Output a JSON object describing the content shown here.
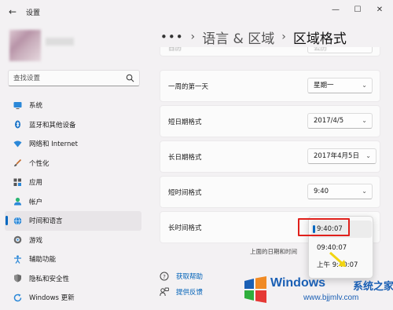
{
  "window": {
    "title": "设置",
    "back_icon": "←",
    "minimize_icon": "—",
    "maximize_icon": "☐",
    "close_icon": "✕"
  },
  "search": {
    "placeholder": "查找设置"
  },
  "sidebar": {
    "items": [
      {
        "label": "系统",
        "icon": "system-icon",
        "active": false
      },
      {
        "label": "蓝牙和其他设备",
        "icon": "bluetooth-icon",
        "active": false
      },
      {
        "label": "网络和 Internet",
        "icon": "network-icon",
        "active": false
      },
      {
        "label": "个性化",
        "icon": "brush-icon",
        "active": false
      },
      {
        "label": "应用",
        "icon": "apps-icon",
        "active": false
      },
      {
        "label": "帐户",
        "icon": "account-icon",
        "active": false
      },
      {
        "label": "时间和语言",
        "icon": "globe-icon",
        "active": true
      },
      {
        "label": "游戏",
        "icon": "game-icon",
        "active": false
      },
      {
        "label": "辅助功能",
        "icon": "accessibility-icon",
        "active": false
      },
      {
        "label": "隐私和安全性",
        "icon": "shield-icon",
        "active": false
      },
      {
        "label": "Windows 更新",
        "icon": "update-icon",
        "active": false
      }
    ]
  },
  "breadcrumb": {
    "more": "•••",
    "sep1": "›",
    "item1": "语言 & 区域",
    "sep2": "›",
    "current": "区域格式"
  },
  "settings": {
    "partial_row": {
      "label": "日历",
      "value": "公历"
    },
    "rows": [
      {
        "label": "一周的第一天",
        "value": "星期一"
      },
      {
        "label": "短日期格式",
        "value": "2017/4/5"
      },
      {
        "label": "长日期格式",
        "value": "2017年4月5日"
      },
      {
        "label": "短时间格式",
        "value": "9:40"
      },
      {
        "label": "长时间格式",
        "value": ""
      }
    ],
    "chevron": "⌄"
  },
  "long_time_options": {
    "items": [
      "9:40:07",
      "09:40:07",
      "上午 9:40:07"
    ],
    "selected": "9:40:07"
  },
  "note": "上面的日期和时间",
  "links": [
    {
      "label": "获取帮助",
      "icon": "help-icon"
    },
    {
      "label": "提供反馈",
      "icon": "feedback-icon"
    }
  ],
  "watermark": {
    "name": "Windows",
    "tagline": "系统之家",
    "url": "www.bjjmlv.com"
  },
  "colors": {
    "accent": "#0067c0",
    "highlight": "#e0201b",
    "link": "#0062b8"
  }
}
